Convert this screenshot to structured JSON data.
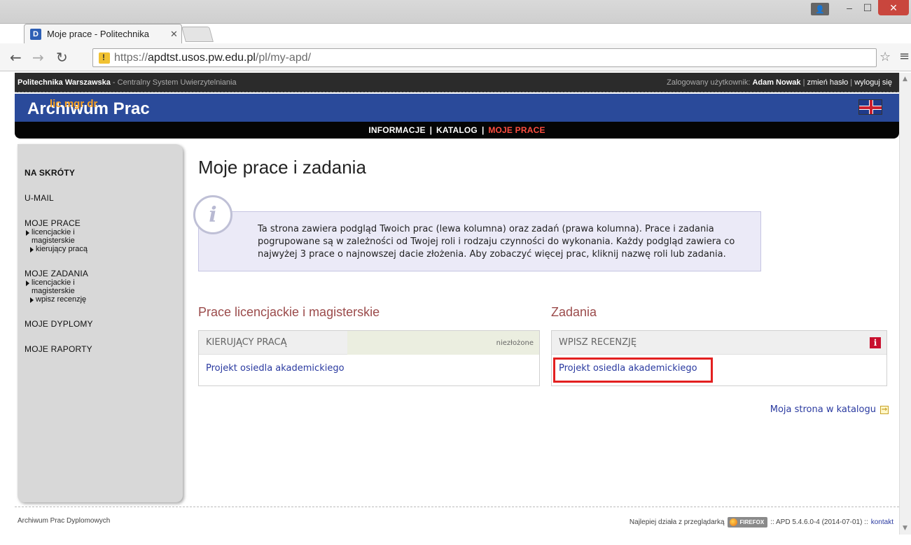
{
  "browser": {
    "tab_title": "Moje prace - Politechnika",
    "favicon": "D",
    "url_scheme": "https://",
    "url_host": "apdtst.usos.pw.edu.pl",
    "url_path": "/pl/my-apd/"
  },
  "topbar": {
    "org": "Politechnika Warszawska",
    "org_suffix": " - Centralny System Uwierzytelniania",
    "logged_prefix": "Zalogowany użytkownik: ",
    "user": "Adam Nowak",
    "change_password": "zmień hasło",
    "logout": "wyloguj się",
    "separator": " | "
  },
  "banner": {
    "title": "Archiwum Prac",
    "subtitle": "lic mgr dr"
  },
  "menu": {
    "items": [
      "INFORMACJE",
      "KATALOG",
      "MOJE PRACE"
    ],
    "separator": "|",
    "active": "MOJE PRACE"
  },
  "sidebar": {
    "shortcuts": "NA SKRÓTY",
    "umail": "U-MAIL",
    "my_works": "MOJE PRACE",
    "my_works_sub": "licencjackie i",
    "my_works_sub2": "magisterskie",
    "my_works_role": "kierujący pracą",
    "my_tasks": "MOJE ZADANIA",
    "my_tasks_sub": "licencjackie i",
    "my_tasks_sub2": "magisterskie",
    "my_tasks_role": "wpisz recenzję",
    "my_diplomas": "MOJE DYPLOMY",
    "my_reports": "MOJE RAPORTY"
  },
  "main": {
    "title": "Moje prace i zadania",
    "info": "Ta strona zawiera podgląd Twoich prac (lewa kolumna) oraz zadań (prawa kolumna). Prace i zadania pogrupowane są w zależności od Twojej roli i rodzaju czynności do wykonania. Każdy podgląd zawiera co najwyżej 3 prace o najnowszej dacie złożenia. Aby zobaczyć więcej prac, kliknij nazwę roli lub zadania.",
    "left_heading": "Prace licencjackie i magisterskie",
    "left_box_head": "KIERUJĄCY PRACĄ",
    "left_box_status": "niezłożone",
    "left_box_link": "Projekt osiedla akademickiego",
    "right_heading": "Zadania",
    "right_box_head": "WPISZ RECENZJĘ",
    "right_box_link": "Projekt osiedla akademickiego",
    "catalog_link": "Moja strona w katalogu"
  },
  "footer": {
    "left": "Archiwum Prac Dyplomowych",
    "best_with": "Najlepiej działa z przeglądarką",
    "firefox": "FIREFOX",
    "version": ":: APD 5.4.6.0-4 (2014-07-01) ::",
    "contact": "kontakt"
  },
  "colors": {
    "banner": "#2a4a9a",
    "menu_active": "#ff4d3f",
    "heading": "#9b4b4b",
    "link": "#2a3aa0",
    "highlight": "#e32020"
  }
}
